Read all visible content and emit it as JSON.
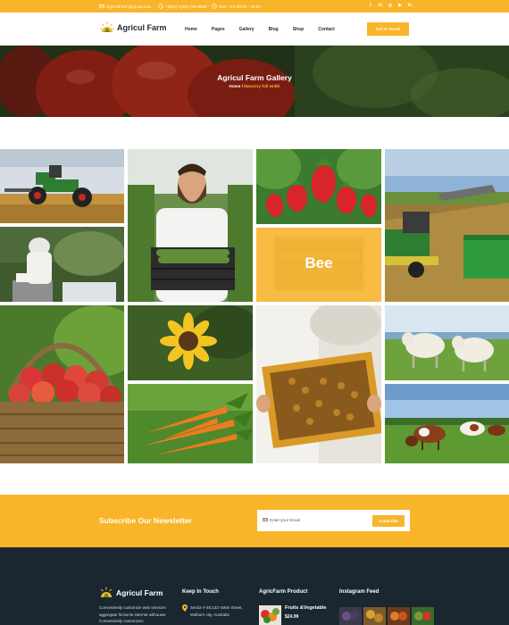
{
  "topbar": {
    "email": "AgriculFarm@gmail.com",
    "phone": "+88(0)-1(80)-745-6983",
    "hours": "Mon - Fri 09:00 - 18:00",
    "social": [
      "twitter",
      "linkedin",
      "instagram",
      "youtube",
      "linkedin"
    ]
  },
  "brand": {
    "name": "Agricul Farm"
  },
  "nav": {
    "items": [
      "Home",
      "Pages",
      "Gallery",
      "Blog",
      "Shop",
      "Contact"
    ],
    "cta": "Get in Touch"
  },
  "hero": {
    "title": "Agricul Farm Gallery",
    "crumb_home": "Home",
    "crumb_sep": " / ",
    "crumb_current": "Masonry full width"
  },
  "gallery": {
    "bee_label": "Bee",
    "tiles": [
      "tractor",
      "farmer-cucumbers",
      "strawberries",
      "harvester",
      "beekeeper",
      "bee-card",
      "apples-basket",
      "sunflower",
      "honeycomb",
      "sheep",
      "carrots",
      "cows"
    ]
  },
  "newsletter": {
    "title": "Subscribe Our Newsletter",
    "placeholder": "Enter your Email",
    "button": "Subscribe"
  },
  "footer": {
    "brand": "Agricul Farm",
    "about_lines": [
      "Conveniently customize web services",
      "aggregate frictionle internet withouwe",
      "Conveniently customizec"
    ],
    "col2_title": "Keep In Touch",
    "address_lines": [
      "Sector # 48,123 Vokte Street,",
      "Molborn city, Australia"
    ],
    "col3_title": "AgricFarm Product",
    "product_name": "Fruits &Vegetable",
    "product_price": "$24.99",
    "col4_title": "Instagram Feed"
  },
  "colors": {
    "accent": "#f9b529",
    "dark": "#1b2730"
  }
}
